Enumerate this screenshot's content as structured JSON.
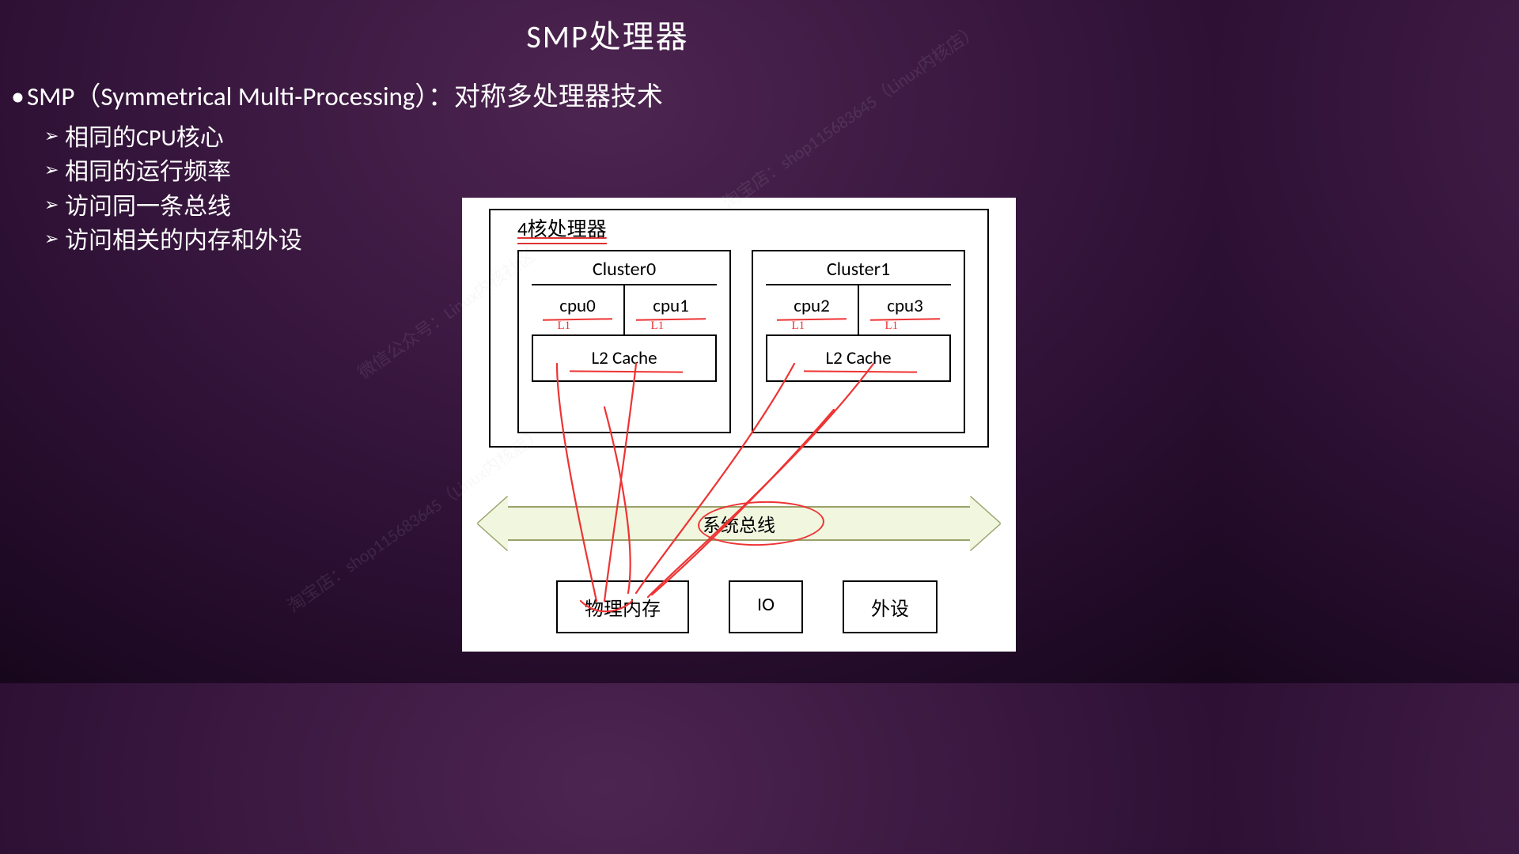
{
  "title": "SMP处理器",
  "bullet_main": "SMP（Symmetrical Multi-Processing）：对称多处理器技术",
  "sub": [
    "相同的CPU核心",
    "相同的运行频率",
    "访问同一条总线",
    "访问相关的内存和外设"
  ],
  "diagram": {
    "proc_title": "4核处理器",
    "clusters": [
      {
        "label": "Cluster0",
        "cpus": [
          "cpu0",
          "cpu1"
        ],
        "l2": "L2 Cache",
        "l1_mark": "L1"
      },
      {
        "label": "Cluster1",
        "cpus": [
          "cpu2",
          "cpu3"
        ],
        "l2": "L2 Cache",
        "l1_mark": "L1"
      }
    ],
    "bus": "系统总线",
    "devices": [
      "物理内存",
      "IO",
      "外设"
    ]
  },
  "watermarks": [
    "微信公众号：Linux内核社区",
    "淘宝店：shop115683645（Linux内核店）"
  ]
}
